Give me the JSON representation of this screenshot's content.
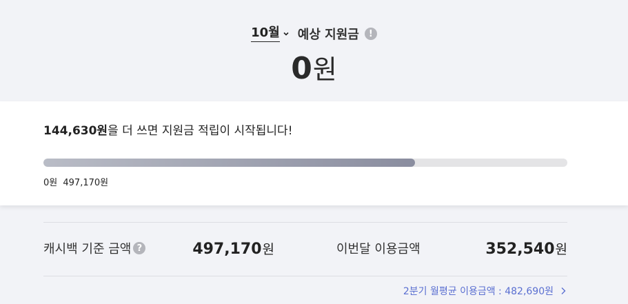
{
  "header": {
    "month": "10월",
    "estimate_label": "예상 지원금",
    "info_glyph": "!",
    "amount_value": "0",
    "amount_unit": "원"
  },
  "progress": {
    "message_amount": "144,630원",
    "message_rest": "을 더 쓰면 지원금 적립이 시작됩니다!",
    "fill_fraction": 0.709,
    "start_label": "0원",
    "current_label": "497,170원"
  },
  "stats": {
    "cashback_label": "캐시백 기준 금액",
    "help_glyph": "?",
    "cashback_value": "497,170",
    "cashback_unit": "원",
    "monthly_label": "이번달 이용금액",
    "monthly_value": "352,540",
    "monthly_unit": "원"
  },
  "quarter": {
    "label": "2분기 월평균 이용금액 : 482,690원"
  },
  "colors": {
    "link": "#5a6fd1",
    "progress_fill_start": "#b9bcc6",
    "progress_fill_end": "#8a8d9f",
    "track": "#e4e4e6"
  }
}
